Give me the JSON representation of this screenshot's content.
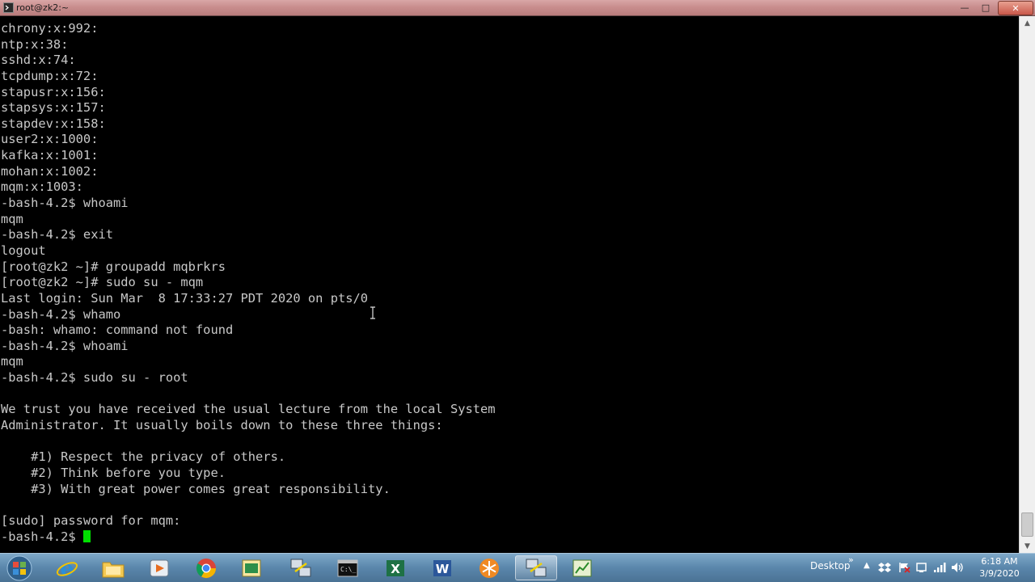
{
  "window": {
    "title": "root@zk2:~",
    "minimize_label": "—",
    "maximize_label": "□",
    "close_label": "✕"
  },
  "terminal": {
    "lines": [
      "chrony:x:992:",
      "ntp:x:38:",
      "sshd:x:74:",
      "tcpdump:x:72:",
      "stapusr:x:156:",
      "stapsys:x:157:",
      "stapdev:x:158:",
      "user2:x:1000:",
      "kafka:x:1001:",
      "mohan:x:1002:",
      "mqm:x:1003:",
      "-bash-4.2$ whoami",
      "mqm",
      "-bash-4.2$ exit",
      "logout",
      "[root@zk2 ~]# groupadd mqbrkrs",
      "[root@zk2 ~]# sudo su - mqm",
      "Last login: Sun Mar  8 17:33:27 PDT 2020 on pts/0",
      "-bash-4.2$ whamo",
      "-bash: whamo: command not found",
      "-bash-4.2$ whoami",
      "mqm",
      "-bash-4.2$ sudo su - root",
      "",
      "We trust you have received the usual lecture from the local System",
      "Administrator. It usually boils down to these three things:",
      "",
      "    #1) Respect the privacy of others.",
      "    #2) Think before you type.",
      "    #3) With great power comes great responsibility.",
      "",
      "[sudo] password for mqm:"
    ],
    "prompt": "-bash-4.2$ ",
    "cursor_color": "#00e000",
    "text_color": "#c8c8c8",
    "background": "#000000"
  },
  "scrollbar": {
    "up_arrow": "▲",
    "down_arrow": "▼"
  },
  "taskbar": {
    "items": [
      {
        "name": "internet-explorer",
        "icon": "ie-icon"
      },
      {
        "name": "file-explorer",
        "icon": "folder-icon"
      },
      {
        "name": "media-player",
        "icon": "media-icon"
      },
      {
        "name": "chrome",
        "icon": "chrome-icon"
      },
      {
        "name": "app-window",
        "icon": "window-app-icon"
      },
      {
        "name": "network-putty",
        "icon": "putty-icon"
      },
      {
        "name": "command-prompt",
        "icon": "cmd-icon"
      },
      {
        "name": "excel",
        "icon": "excel-icon"
      },
      {
        "name": "word",
        "icon": "word-icon"
      },
      {
        "name": "snowflake-app",
        "icon": "snowflake-icon"
      },
      {
        "name": "putty-active",
        "icon": "putty-icon"
      },
      {
        "name": "chart-app",
        "icon": "chart-app-icon"
      }
    ],
    "desktop_label": "Desktop",
    "desktop_chevron": "»",
    "tray_arrow": "▲",
    "clock_time": "6:18 AM",
    "clock_date": "3/9/2020"
  }
}
